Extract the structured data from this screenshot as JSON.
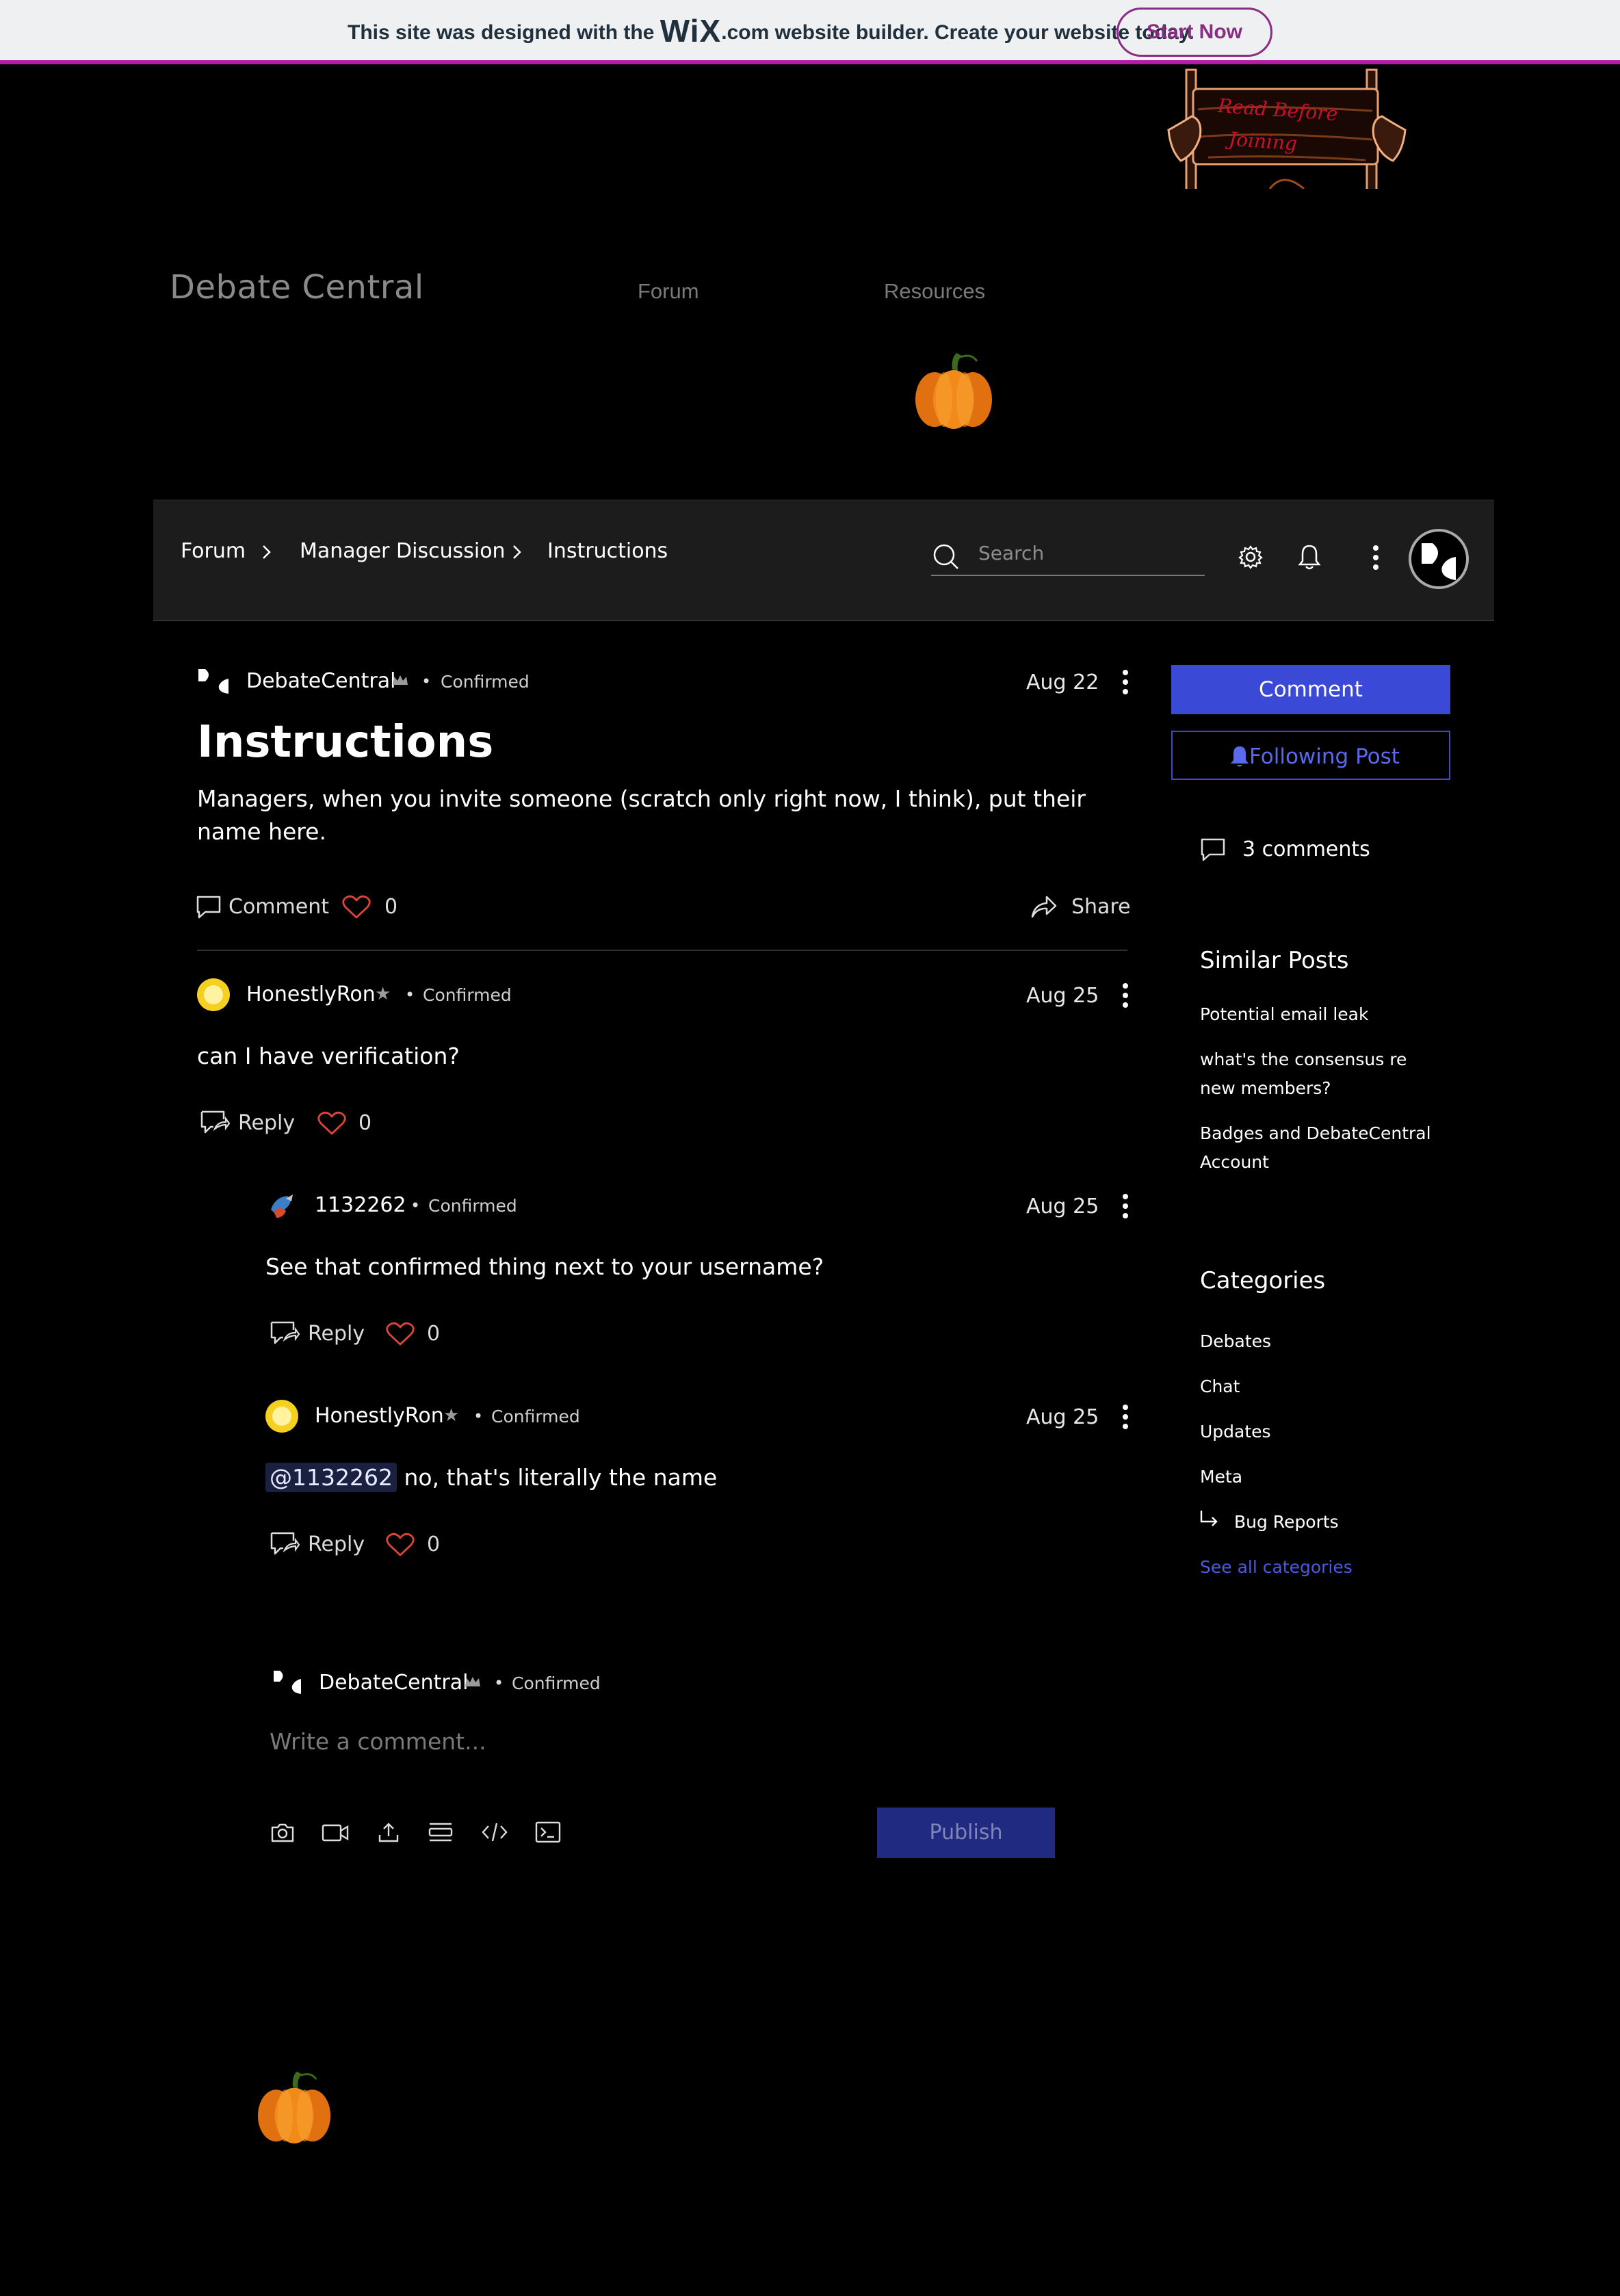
{
  "wix_banner": {
    "text_before": "This site was designed with the ",
    "wix_logo": "WiX",
    "text_after": ".com website builder. Create your website today.",
    "cta": "Start Now"
  },
  "sign": {
    "line1": "Read Before",
    "line2": "Joining"
  },
  "header": {
    "site_title": "Debate Central",
    "nav": [
      "Forum",
      "Resources"
    ]
  },
  "toolbar": {
    "breadcrumb": [
      "Forum",
      "Manager Discussion",
      "Instructions"
    ],
    "search_placeholder": "Search"
  },
  "post": {
    "author": "DebateCentral",
    "badge": "Confirmed",
    "date": "Aug 22",
    "title": "Instructions",
    "body": "Managers, when you invite someone (scratch only right now, I think), put their name here.",
    "comment_label": "Comment",
    "likes": "0",
    "share_label": "Share"
  },
  "comments": [
    {
      "author": "HonestlyRon",
      "badge": "Confirmed",
      "date": "Aug 25",
      "body": "can I have verification?",
      "reply_label": "Reply",
      "likes": "0"
    },
    {
      "author": "1132262",
      "badge": "Confirmed",
      "date": "Aug 25",
      "body": "See that confirmed thing next to your username?",
      "reply_label": "Reply",
      "likes": "0"
    },
    {
      "author": "HonestlyRon",
      "badge": "Confirmed",
      "date": "Aug 25",
      "mention": "@1132262",
      "body": " no, that's literally the name",
      "reply_label": "Reply",
      "likes": "0"
    }
  ],
  "editor": {
    "author": "DebateCentral",
    "badge": "Confirmed",
    "placeholder": "Write a comment...",
    "publish": "Publish"
  },
  "sidebar": {
    "comment_button": "Comment",
    "follow_button": "Following Post",
    "comment_count": "3 comments",
    "similar_title": "Similar Posts",
    "similar_posts": [
      "Potential email leak",
      "what's the consensus re new members?",
      "Badges and DebateCentral Account"
    ],
    "categories_title": "Categories",
    "categories": [
      "Debates",
      "Chat",
      "Updates",
      "Meta"
    ],
    "subcategory": "Bug Reports",
    "see_all": "See all categories"
  },
  "colors": {
    "accent": "#3b4ad6",
    "wix_border": "#b41ca8",
    "like_heart": "#e0453a"
  }
}
